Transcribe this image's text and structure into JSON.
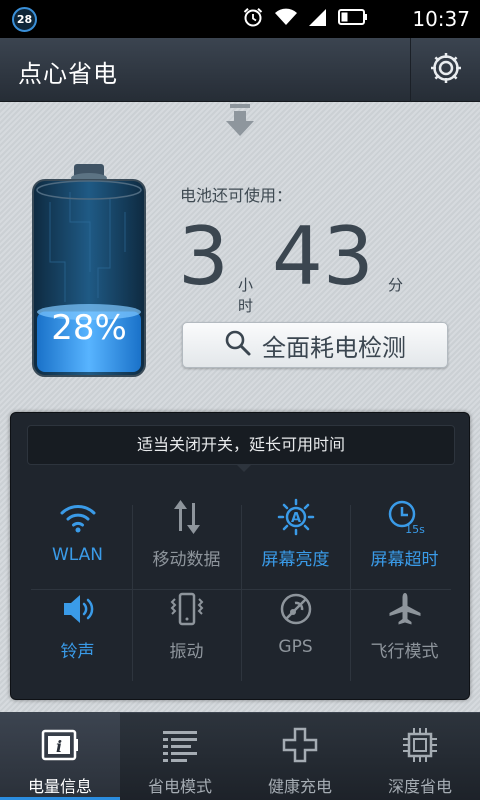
{
  "status_bar": {
    "badge": "28",
    "time": "10:37",
    "icons": [
      "alarm-clock-icon",
      "wifi-icon",
      "signal-icon",
      "battery-icon"
    ]
  },
  "header": {
    "title": "点心省电",
    "settings_icon": "gear-icon"
  },
  "battery": {
    "percent_text": "28%",
    "level": 0.28
  },
  "remaining": {
    "label": "电池还可使用：",
    "hours": "3",
    "hours_unit": "小时",
    "minutes": "43",
    "minutes_unit": "分"
  },
  "check_button": {
    "label": "全面耗电检测",
    "icon": "search-icon"
  },
  "panel": {
    "tip": "适当关闭开关，延长可用时间",
    "switches": [
      {
        "label": "WLAN",
        "icon": "wifi-icon",
        "on": true
      },
      {
        "label": "移动数据",
        "icon": "data-arrows-icon",
        "on": false
      },
      {
        "label": "屏幕亮度",
        "icon": "brightness-icon",
        "on": true
      },
      {
        "label": "屏幕超时",
        "icon": "timeout-clock-icon",
        "on": true
      },
      {
        "label": "铃声",
        "icon": "speaker-icon",
        "on": true
      },
      {
        "label": "振动",
        "icon": "vibrate-icon",
        "on": false
      },
      {
        "label": "GPS",
        "icon": "gps-icon",
        "on": false
      },
      {
        "label": "飞行模式",
        "icon": "airplane-icon",
        "on": false
      }
    ],
    "timeout_badge": "15s"
  },
  "bottom_nav": {
    "items": [
      {
        "label": "电量信息",
        "icon": "info-icon",
        "active": true
      },
      {
        "label": "省电模式",
        "icon": "list-icon",
        "active": false
      },
      {
        "label": "健康充电",
        "icon": "plus-icon",
        "active": false
      },
      {
        "label": "深度省电",
        "icon": "chip-icon",
        "active": false
      }
    ]
  },
  "colors": {
    "accent": "#3a9be8",
    "off": "#8e959c",
    "header_bg": "#2f3640"
  }
}
